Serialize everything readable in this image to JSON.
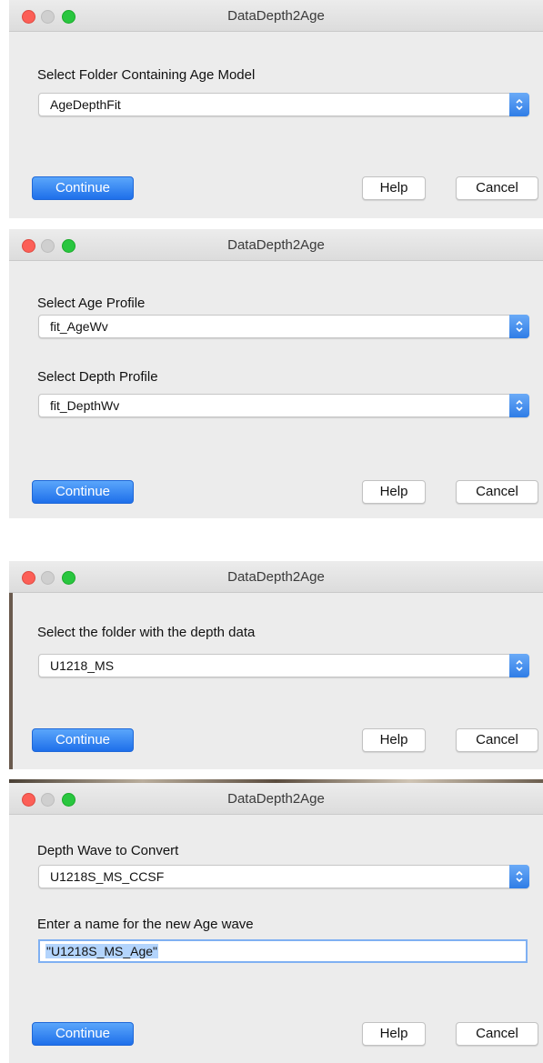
{
  "dialogs": [
    {
      "title": "DataDepth2Age",
      "field1_label": "Select Folder Containing Age Model",
      "field1_value": "AgeDepthFit",
      "continue_label": "Continue",
      "help_label": "Help",
      "cancel_label": "Cancel"
    },
    {
      "title": "DataDepth2Age",
      "field1_label": "Select Age Profile",
      "field1_value": "fit_AgeWv",
      "field2_label": "Select Depth Profile",
      "field2_value": "fit_DepthWv",
      "continue_label": "Continue",
      "help_label": "Help",
      "cancel_label": "Cancel"
    },
    {
      "title": "DataDepth2Age",
      "field1_label": "Select the folder with the depth data",
      "field1_value": "U1218_MS",
      "continue_label": "Continue",
      "help_label": "Help",
      "cancel_label": "Cancel"
    },
    {
      "title": "DataDepth2Age",
      "field1_label": "Depth Wave to Convert",
      "field1_value": "U1218S_MS_CCSF",
      "field2_label": "Enter a name for the new Age wave",
      "field2_value": "\"U1218S_MS_Age\"",
      "continue_label": "Continue",
      "help_label": "Help",
      "cancel_label": "Cancel"
    }
  ],
  "icons": {
    "traffic_lights": [
      "close-icon",
      "minimize-icon",
      "zoom-icon"
    ],
    "popup_arrows": "up-down-chevron-icon"
  },
  "colors": {
    "accent": "#2f7de6",
    "close": "#fc5f57",
    "zoom": "#29c63f",
    "window_bg": "#ececec",
    "selection": "#b3d4fc"
  }
}
